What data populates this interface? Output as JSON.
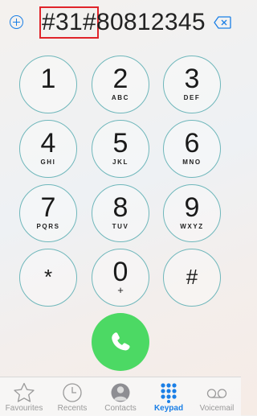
{
  "dialer": {
    "number_highlighted": "#31#",
    "number_rest": "80812345"
  },
  "keys": [
    {
      "digit": "1",
      "letters": ""
    },
    {
      "digit": "2",
      "letters": "ABC"
    },
    {
      "digit": "3",
      "letters": "DEF"
    },
    {
      "digit": "4",
      "letters": "GHI"
    },
    {
      "digit": "5",
      "letters": "JKL"
    },
    {
      "digit": "6",
      "letters": "MNO"
    },
    {
      "digit": "7",
      "letters": "PQRS"
    },
    {
      "digit": "8",
      "letters": "TUV"
    },
    {
      "digit": "9",
      "letters": "WXYZ"
    },
    {
      "digit": "*",
      "letters": ""
    },
    {
      "digit": "0",
      "letters": "+"
    },
    {
      "digit": "#",
      "letters": ""
    }
  ],
  "tabs": [
    {
      "label": "Favourites",
      "icon": "star-icon"
    },
    {
      "label": "Recents",
      "icon": "clock-icon"
    },
    {
      "label": "Contacts",
      "icon": "contact-icon"
    },
    {
      "label": "Keypad",
      "icon": "keypad-icon",
      "active": true
    },
    {
      "label": "Voicemail",
      "icon": "voicemail-icon"
    }
  ],
  "colors": {
    "accent": "#1a7fe6",
    "key_border": "#6fb7bb",
    "call": "#4cd964",
    "highlight_box": "#e0242a"
  }
}
